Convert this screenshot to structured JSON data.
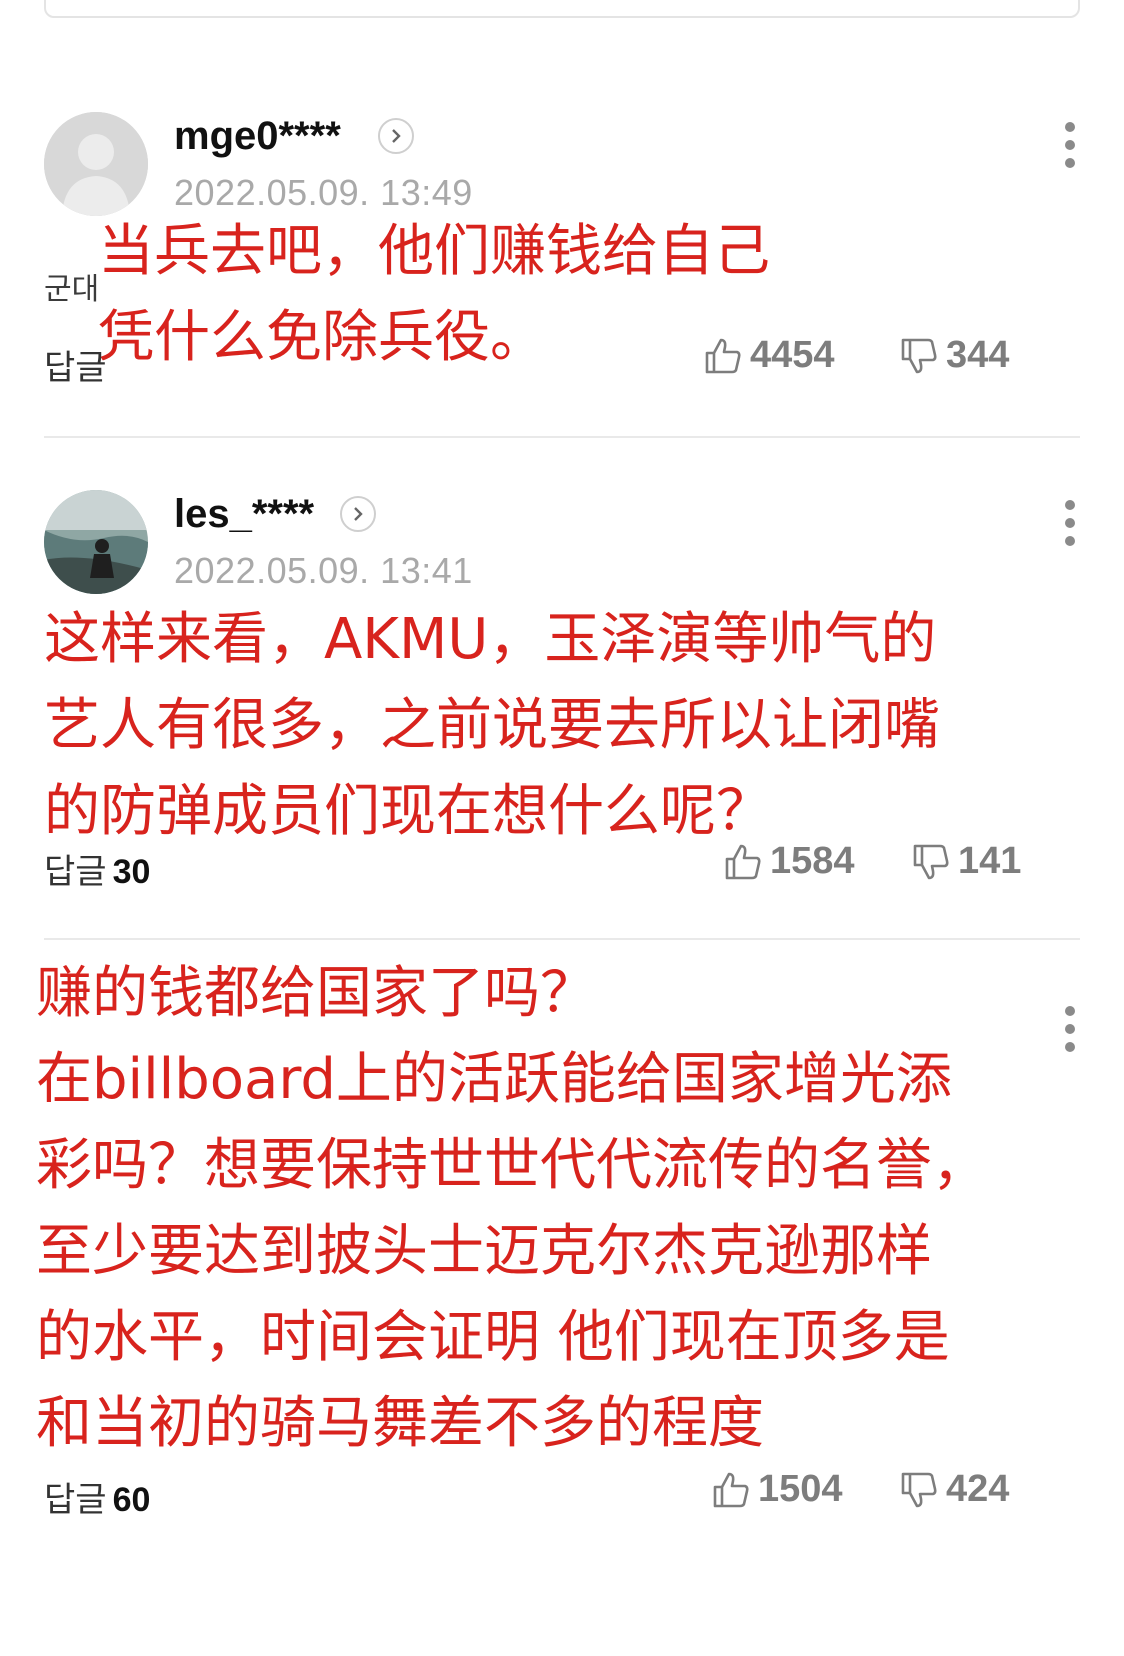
{
  "comments": [
    {
      "username": "mge0****",
      "timestamp": "2022.05.09. 13:49",
      "faint_text": "군대",
      "reply_label": "답글",
      "reply_count": "",
      "likes": "4454",
      "dislikes": "344",
      "overlay_lines": [
        "当兵去吧，他们赚钱给自己",
        "凭什么免除兵役。"
      ]
    },
    {
      "username": "les_****",
      "timestamp": "2022.05.09. 13:41",
      "faint_text": "",
      "reply_label": "답글",
      "reply_count": "30",
      "likes": "1584",
      "dislikes": "141",
      "overlay_lines": [
        "这样来看，AKMU，玉泽演等帅气的",
        "艺人有很多，之前说要去所以让闭嘴",
        "的防弹成员们现在想什么呢？"
      ]
    },
    {
      "username": "",
      "timestamp": "",
      "faint_text": "",
      "reply_label": "답글",
      "reply_count": "60",
      "likes": "1504",
      "dislikes": "424",
      "overlay_lines": [
        "赚的钱都给国家了吗？",
        "在billboard上的活跃能给国家增光添",
        "彩吗？想要保持世世代代流传的名誉，",
        "至少要达到披头士迈克尔杰克逊那样",
        "的水平，时间会证明 他们现在顶多是",
        "和当初的骑马舞差不多的程度"
      ]
    }
  ],
  "colors": {
    "overlay": "#d8231d",
    "timestamp": "#a9a9a9",
    "vote": "#7d7d7d"
  },
  "icons": [
    "person-silhouette-icon",
    "chevron-right-icon",
    "kebab-menu-icon",
    "thumbs-up-icon",
    "thumbs-down-icon"
  ]
}
